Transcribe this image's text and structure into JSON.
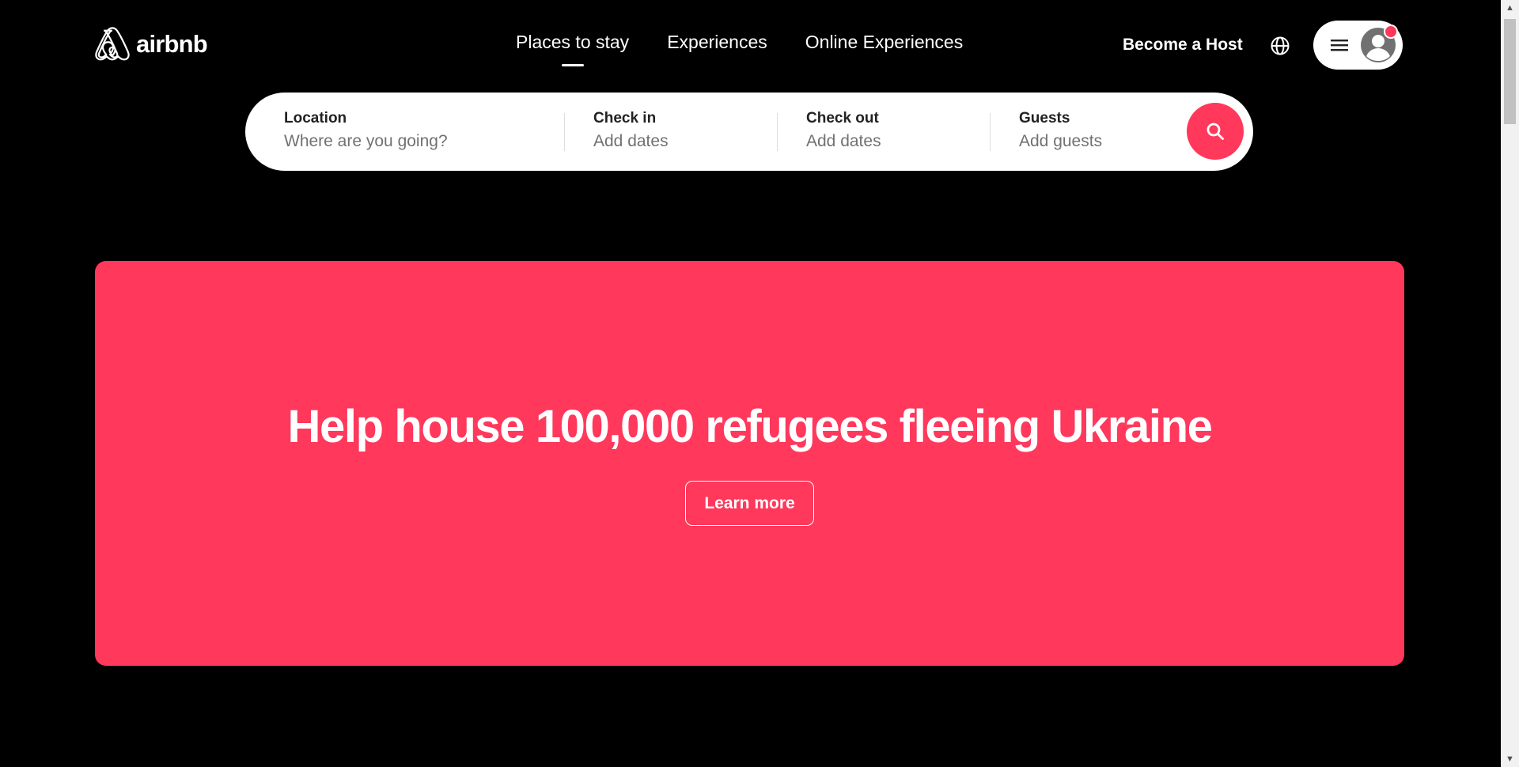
{
  "header": {
    "logo_text": "airbnb",
    "nav_tabs": [
      {
        "label": "Places to stay",
        "active": true
      },
      {
        "label": "Experiences",
        "active": false
      },
      {
        "label": "Online Experiences",
        "active": false
      }
    ],
    "host_link": "Become a Host",
    "globe_icon": "globe-icon",
    "menu_icon": "hamburger-icon",
    "avatar_icon": "user-avatar-icon",
    "notification": true
  },
  "search": {
    "location": {
      "label": "Location",
      "placeholder": "Where are you going?"
    },
    "check_in": {
      "label": "Check in",
      "placeholder": "Add dates"
    },
    "check_out": {
      "label": "Check out",
      "placeholder": "Add dates"
    },
    "guests": {
      "label": "Guests",
      "placeholder": "Add guests"
    },
    "button_icon": "search-icon"
  },
  "banner": {
    "heading": "Help house 100,000 refugees fleeing Ukraine",
    "button_label": "Learn more"
  },
  "colors": {
    "background": "#000000",
    "brand": "#ff385c",
    "text_light": "#ffffff",
    "placeholder": "#717171"
  }
}
